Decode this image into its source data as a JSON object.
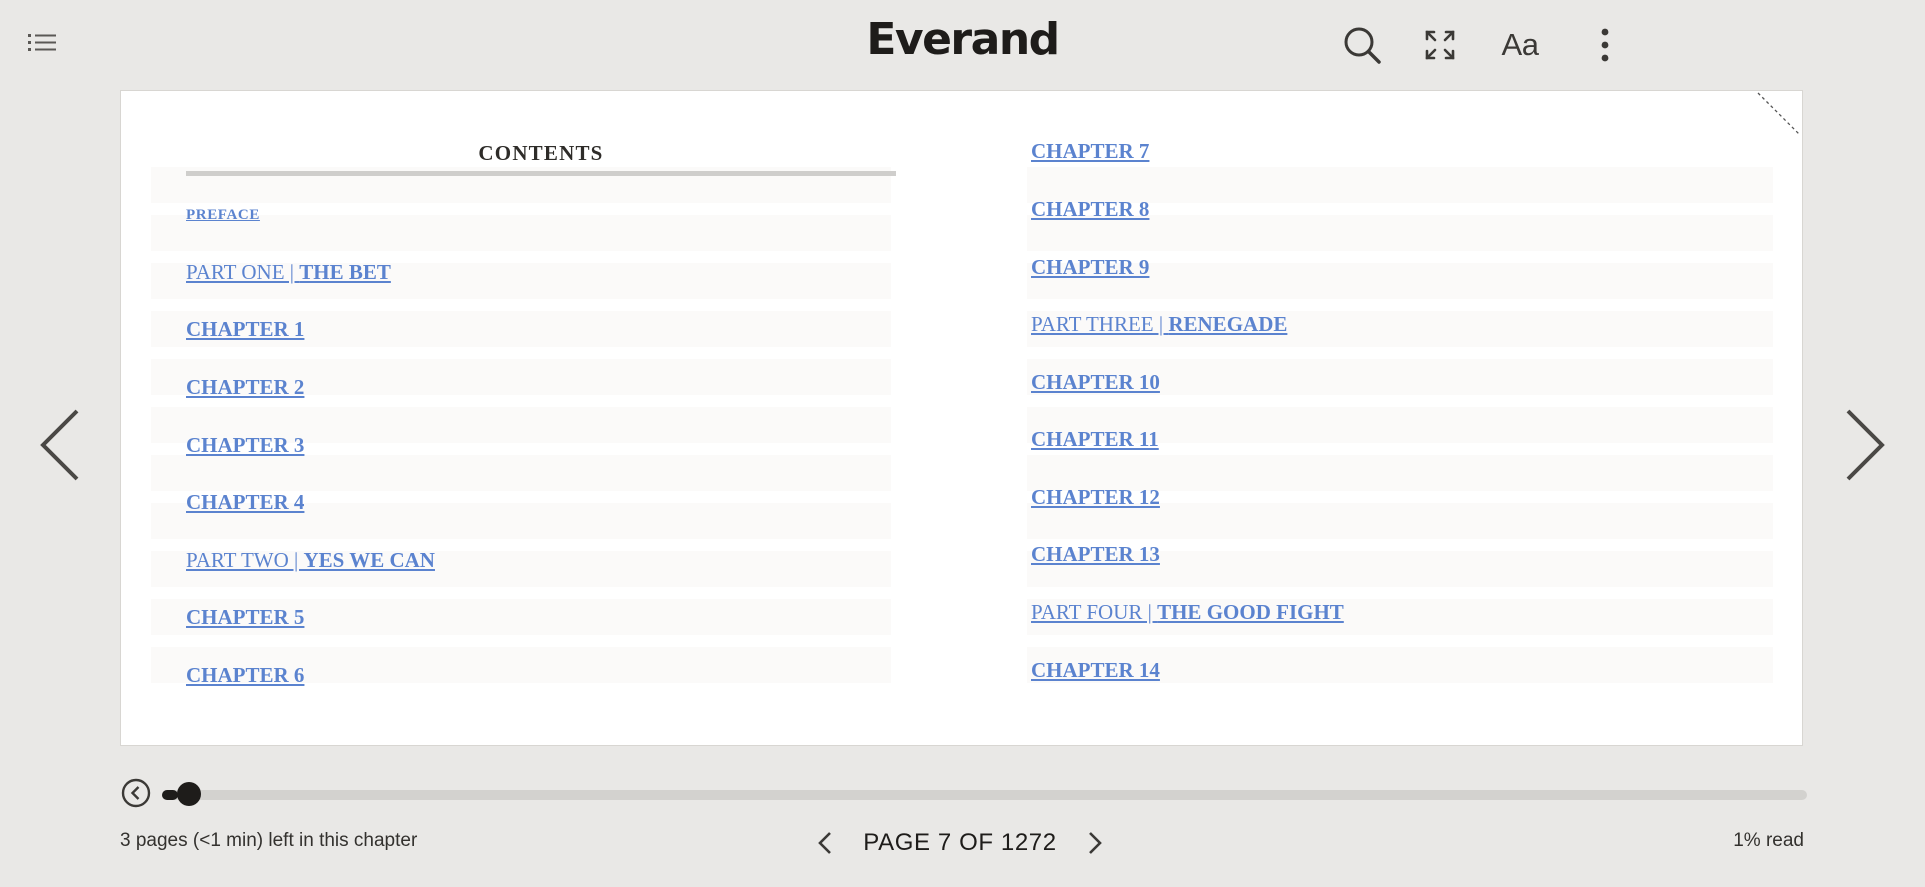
{
  "app": {
    "logo_text": "Everand"
  },
  "toolbar": {
    "toc_icon": "list-icon",
    "search_icon": "search-icon",
    "fullscreen_icon": "expand-icon",
    "font_settings_label": "Aa",
    "more_icon": "kebab-menu-icon"
  },
  "page": {
    "left_column": {
      "heading": "CONTENTS",
      "entries": [
        {
          "prefix": "",
          "title": "PREFACE"
        },
        {
          "prefix": "PART ONE | ",
          "title": "THE BET"
        },
        {
          "prefix": "",
          "title": "CHAPTER 1"
        },
        {
          "prefix": "",
          "title": "CHAPTER 2"
        },
        {
          "prefix": "",
          "title": "CHAPTER 3"
        },
        {
          "prefix": "",
          "title": "CHAPTER 4"
        },
        {
          "prefix": "PART TWO | ",
          "title": "YES WE CAN"
        },
        {
          "prefix": "",
          "title": "CHAPTER 5"
        },
        {
          "prefix": "",
          "title": "CHAPTER 6"
        }
      ]
    },
    "right_column": {
      "entries": [
        {
          "prefix": "",
          "title": "CHAPTER 7"
        },
        {
          "prefix": "",
          "title": "CHAPTER 8"
        },
        {
          "prefix": "",
          "title": "CHAPTER 9"
        },
        {
          "prefix": "PART THREE | ",
          "title": "RENEGADE"
        },
        {
          "prefix": "",
          "title": "CHAPTER 10"
        },
        {
          "prefix": "",
          "title": "CHAPTER 11"
        },
        {
          "prefix": "",
          "title": "CHAPTER 12"
        },
        {
          "prefix": "",
          "title": "CHAPTER 13"
        },
        {
          "prefix": "PART FOUR | ",
          "title": "THE GOOD FIGHT"
        },
        {
          "prefix": "",
          "title": "CHAPTER 14"
        }
      ]
    }
  },
  "footer": {
    "chapter_remaining": "3 pages (<1 min) left in this chapter",
    "page_indicator": "PAGE 7 OF 1272",
    "percent_read": "1% read",
    "progress_fraction": 0.01
  },
  "colors": {
    "background": "#e9e8e6",
    "link": "#5b83cf",
    "text": "#1e1c1a"
  }
}
